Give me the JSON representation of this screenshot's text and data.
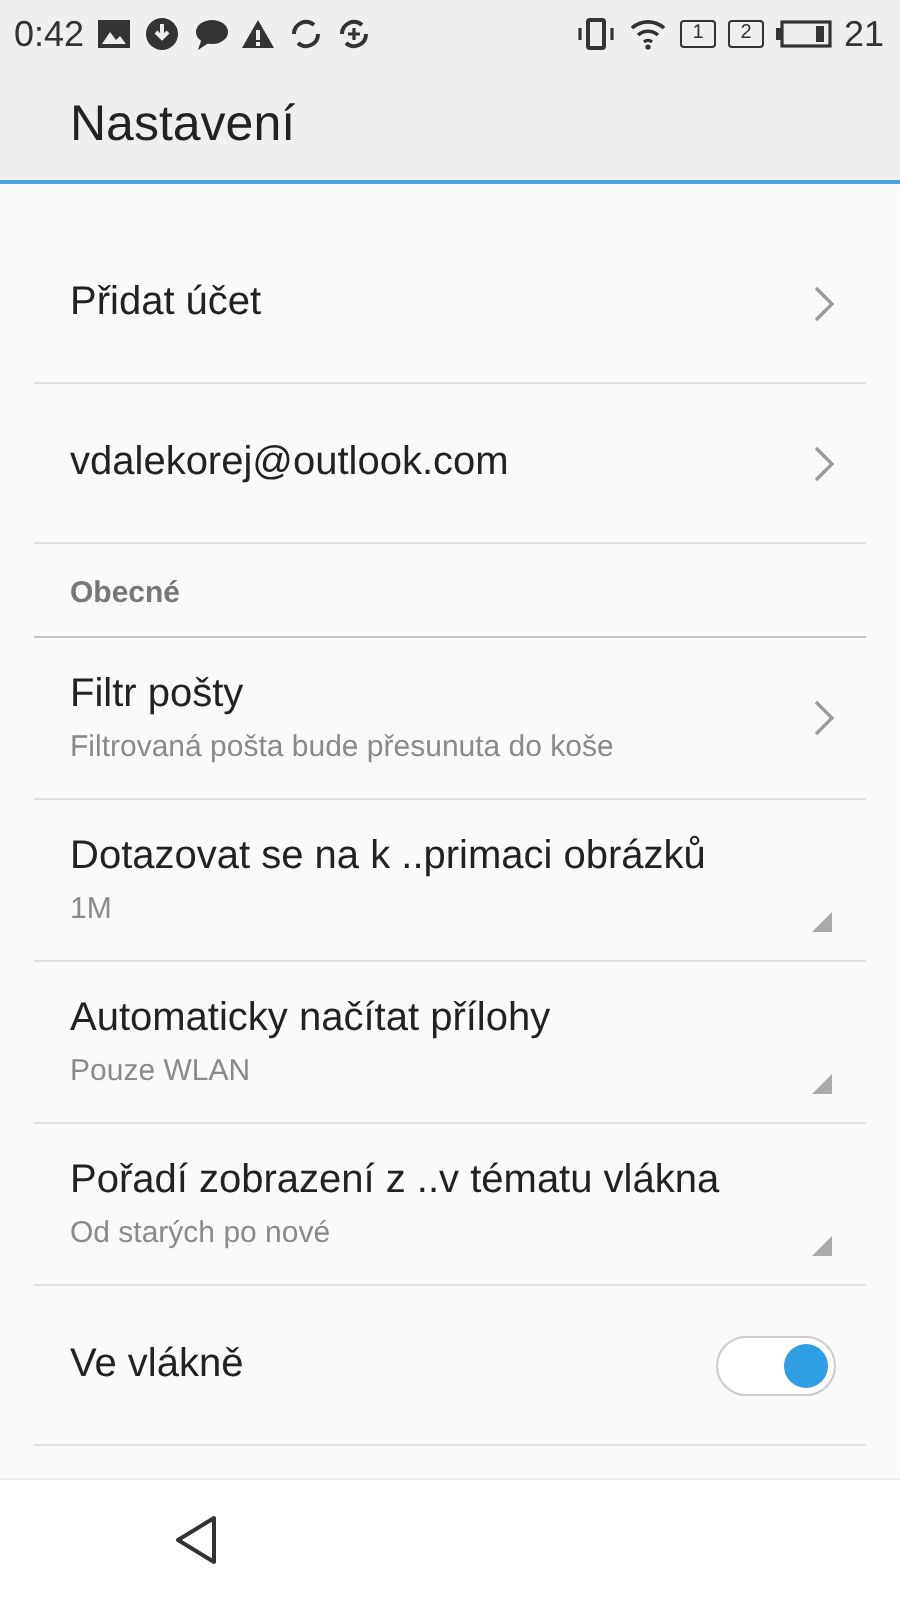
{
  "status_bar": {
    "time": "0:42",
    "sim_1": "1",
    "sim_2": "2",
    "battery": "21"
  },
  "header": {
    "title": "Nastavení"
  },
  "items": [
    {
      "kind": "link",
      "title": "Přidat účet"
    },
    {
      "kind": "link",
      "title": "vdalekorej@outlook.com"
    },
    {
      "kind": "section",
      "title": "Obecné"
    },
    {
      "kind": "link",
      "title": "Filtr pošty",
      "subtitle": "Filtrovaná pošta bude přesunuta do koše"
    },
    {
      "kind": "option",
      "title": "Dotazovat se na k ..primaci obrázků",
      "subtitle": "1M"
    },
    {
      "kind": "option",
      "title": "Automaticky načítat přílohy",
      "subtitle": "Pouze WLAN"
    },
    {
      "kind": "option",
      "title": "Pořadí zobrazení z ..v tématu vlákna",
      "subtitle": "Od starých po nové"
    },
    {
      "kind": "switch",
      "title": "Ve vlákně",
      "on": true
    }
  ]
}
